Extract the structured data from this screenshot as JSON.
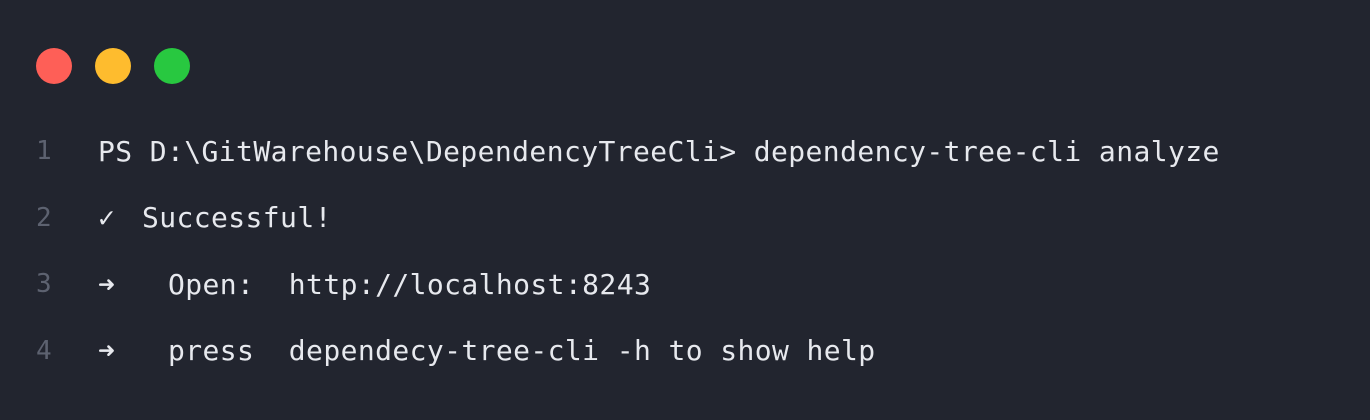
{
  "window": {
    "buttons": {
      "close_color": "#fe5f57",
      "minimize_color": "#febc2e",
      "maximize_color": "#28c840"
    }
  },
  "terminal": {
    "lines": [
      {
        "number": "1",
        "text": "PS D:\\GitWarehouse\\DependencyTreeCli> dependency-tree-cli analyze"
      },
      {
        "number": "2",
        "icon": "check-icon",
        "glyph": "✓",
        "text": "Successful!"
      },
      {
        "number": "3",
        "icon": "arrow-right-icon",
        "glyph": "➜",
        "text": "Open:  http://localhost:8243"
      },
      {
        "number": "4",
        "icon": "arrow-right-icon",
        "glyph": "➜",
        "text": "press  dependecy-tree-cli -h to show help"
      }
    ]
  }
}
